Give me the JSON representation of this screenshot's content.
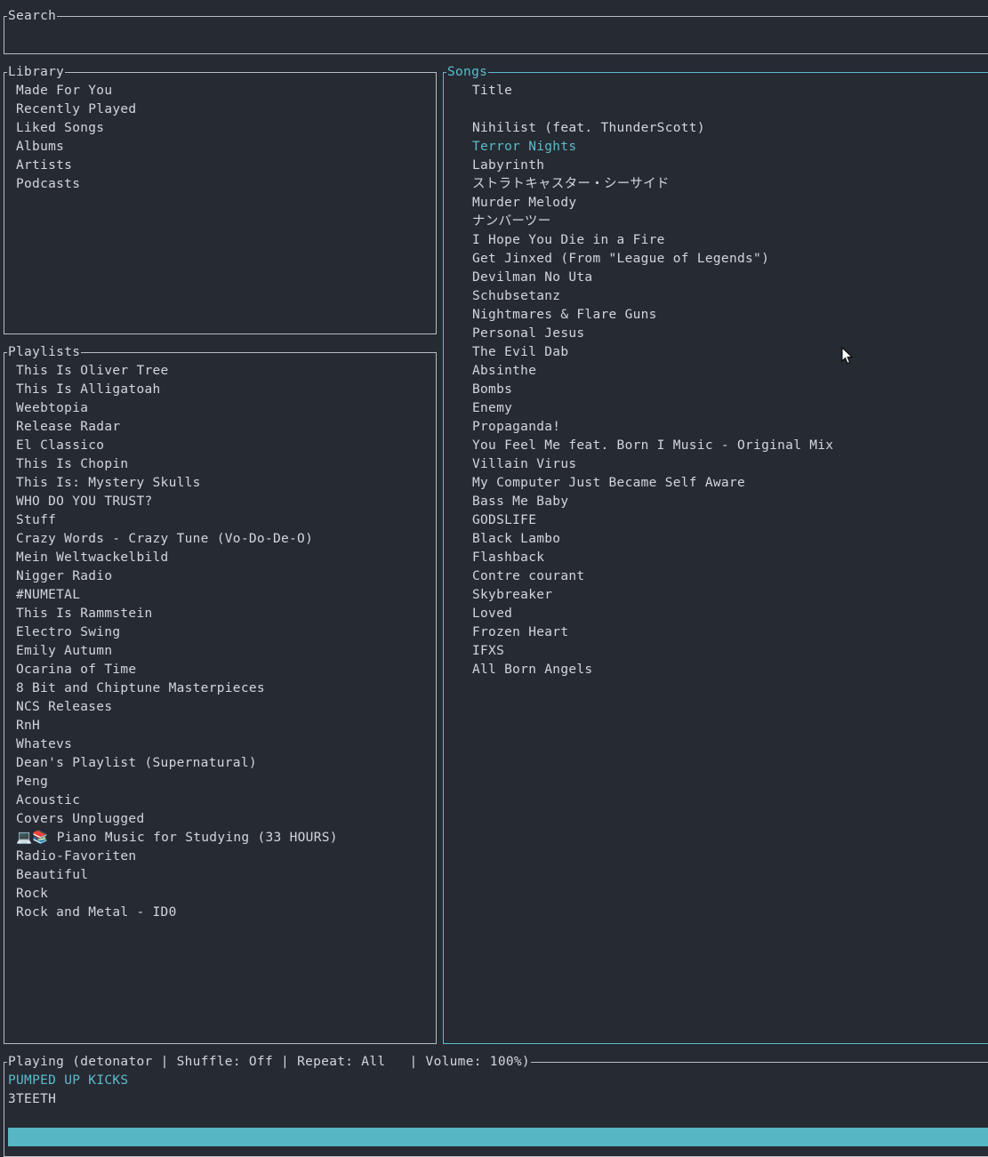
{
  "search": {
    "title": "Search",
    "value": ""
  },
  "library": {
    "title": "Library",
    "items": [
      "Made For You",
      "Recently Played",
      "Liked Songs",
      "Albums",
      "Artists",
      "Podcasts"
    ]
  },
  "playlists": {
    "title": "Playlists",
    "items": [
      "This Is Oliver Tree",
      "This Is Alligatoah",
      "Weebtopia",
      "Release Radar",
      "El Classico",
      "This Is Chopin",
      "This Is: Mystery Skulls",
      "WHO DO YOU TRUST?",
      "Stuff",
      "Crazy Words - Crazy Tune (Vo-Do-De-O)",
      "Mein Weltwackelbild",
      "Nigger Radio",
      "#NUMETAL",
      "This Is Rammstein",
      "Electro Swing",
      "Emily Autumn",
      "Ocarina of Time",
      "8 Bit and Chiptune Masterpieces",
      "NCS Releases",
      "RnH",
      "Whatevs",
      "Dean's Playlist (Supernatural)",
      "Peng",
      "Acoustic",
      "Covers Unplugged",
      "💻📚 Piano Music for Studying (33 HOURS)",
      "Radio-Favoriten",
      "Beautiful",
      "Rock",
      "Rock and Metal - ID0"
    ]
  },
  "songs": {
    "title": "Songs",
    "column_header": "Title",
    "selected_index": 1,
    "items": [
      "Nihilist (feat. ThunderScott)",
      "Terror Nights",
      "Labyrinth",
      "ストラトキャスター・シーサイド",
      "Murder Melody",
      "ナンバーツー",
      "I Hope You Die in a Fire",
      "Get Jinxed (From \"League of Legends\")",
      "Devilman No Uta",
      "Schubsetanz",
      "Nightmares & Flare Guns",
      "Personal Jesus",
      "The Evil Dab",
      "Absinthe",
      "Bombs",
      "Enemy",
      "Propaganda!",
      "You Feel Me feat. Born I Music - Original Mix",
      "Villain Virus",
      "My Computer Just Became Self Aware",
      "Bass Me Baby",
      "GODSLIFE",
      "Black Lambo",
      "Flashback",
      "Contre courant",
      "Skybreaker",
      "Loved",
      "Frozen Heart",
      "IFXS",
      "All Born Angels"
    ]
  },
  "now_playing": {
    "title": "Playing (detonator | Shuffle: Off | Repeat: All   | Volume: 100%)",
    "song": "PUMPED UP KICKS",
    "artist": "3TEETH",
    "progress_fraction": 1.0
  },
  "colors": {
    "background": "#262a33",
    "text": "#d3d6da",
    "accent": "#5bbccb",
    "border": "#b8bcc2"
  },
  "icons": {
    "cursor": "mouse-pointer-icon"
  }
}
